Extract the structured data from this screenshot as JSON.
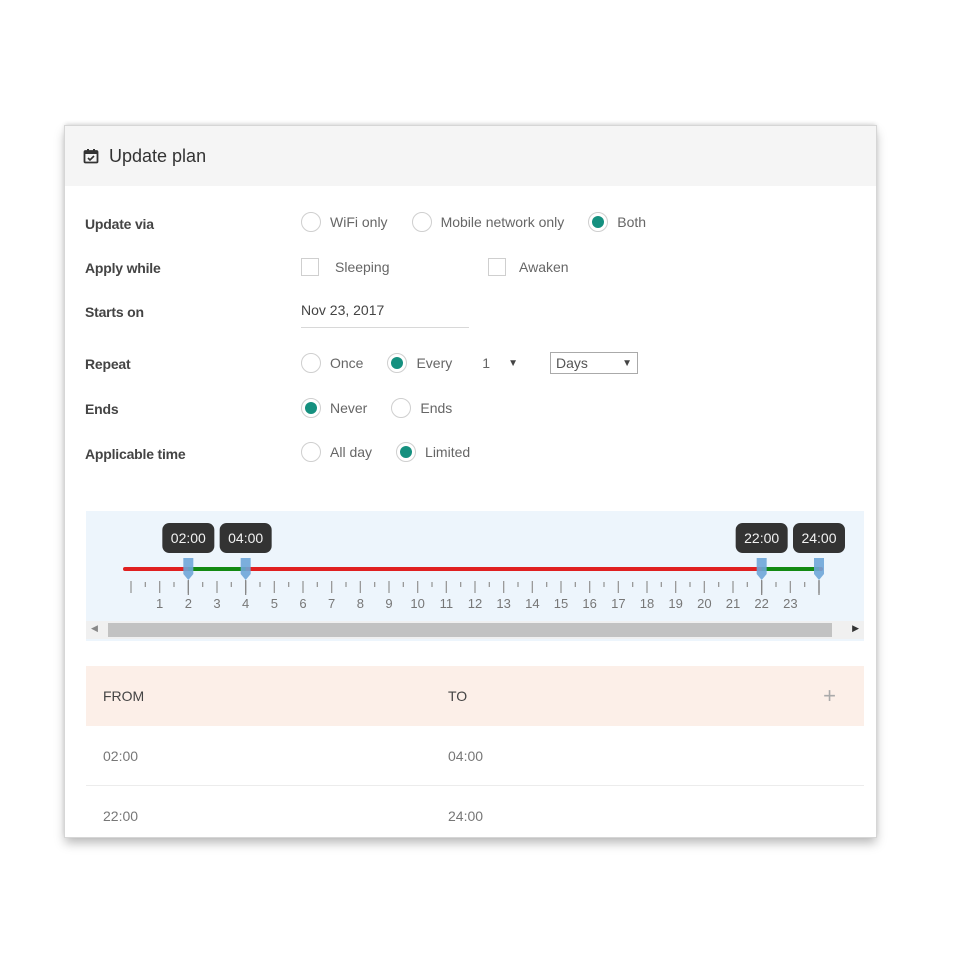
{
  "header": {
    "title": "Update plan",
    "icon": "calendar-check-icon"
  },
  "form": {
    "update_via": {
      "label": "Update via",
      "options": [
        {
          "label": "WiFi only",
          "selected": false
        },
        {
          "label": "Mobile network only",
          "selected": false
        },
        {
          "label": "Both",
          "selected": true
        }
      ]
    },
    "apply_while": {
      "label": "Apply while",
      "options": [
        {
          "label": "Sleeping",
          "checked": false
        },
        {
          "label": "Awaken",
          "checked": false
        }
      ]
    },
    "starts_on": {
      "label": "Starts on",
      "value": "Nov 23, 2017"
    },
    "repeat": {
      "label": "Repeat",
      "options": [
        {
          "label": "Once",
          "selected": false
        },
        {
          "label": "Every",
          "selected": true
        }
      ],
      "interval_value": "1",
      "unit_value": "Days"
    },
    "ends": {
      "label": "Ends",
      "options": [
        {
          "label": "Never",
          "selected": true
        },
        {
          "label": "Ends",
          "selected": false
        }
      ]
    },
    "applicable_time": {
      "label": "Applicable time",
      "options": [
        {
          "label": "All day",
          "selected": false
        },
        {
          "label": "Limited",
          "selected": true
        }
      ]
    }
  },
  "timeline": {
    "range_hours": [
      0,
      24
    ],
    "tick_labels": [
      "1",
      "2",
      "3",
      "4",
      "5",
      "6",
      "7",
      "8",
      "9",
      "10",
      "11",
      "12",
      "13",
      "14",
      "15",
      "16",
      "17",
      "18",
      "19",
      "20",
      "21",
      "22",
      "23"
    ],
    "ranges": [
      {
        "from": 2,
        "to": 4,
        "from_label": "02:00",
        "to_label": "04:00"
      },
      {
        "from": 22,
        "to": 24,
        "from_label": "22:00",
        "to_label": "24:00"
      }
    ],
    "colors": {
      "inactive": "#e02020",
      "active": "#138a13",
      "handle": "#6ea6d8",
      "tooltip": "#333333",
      "accent": "#15907f"
    }
  },
  "table": {
    "headers": {
      "from": "FROM",
      "to": "TO"
    },
    "add_label": "+",
    "rows": [
      {
        "from": "02:00",
        "to": "04:00"
      },
      {
        "from": "22:00",
        "to": "24:00"
      }
    ]
  }
}
